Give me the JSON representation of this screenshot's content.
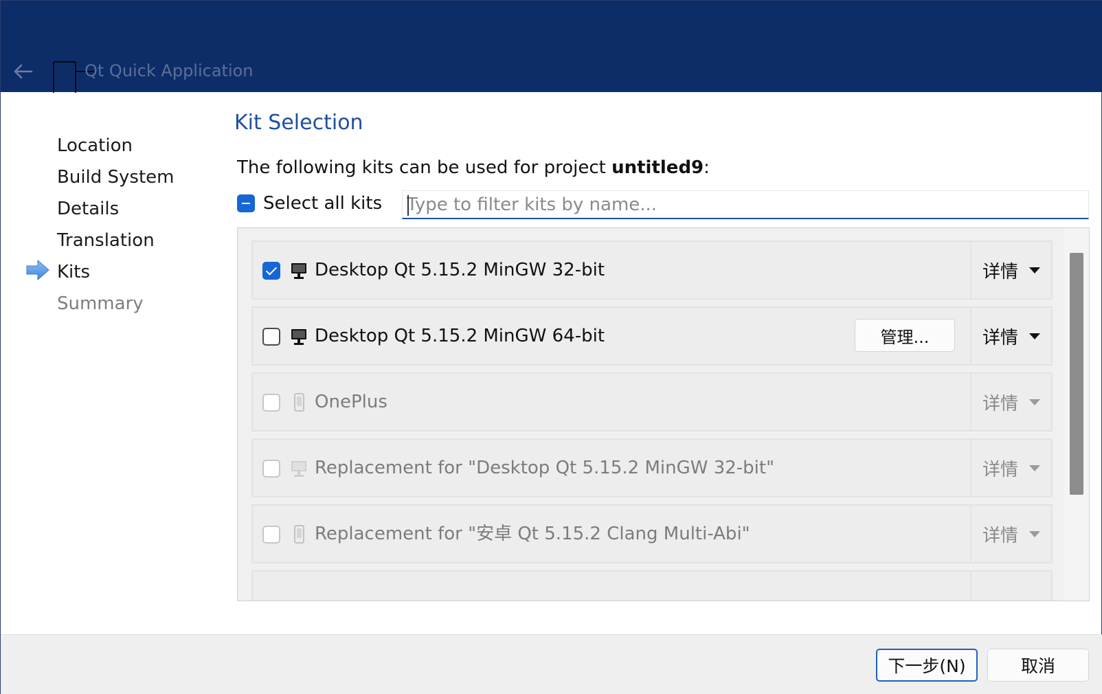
{
  "window": {
    "title": "Qt Quick Application"
  },
  "sidebar": {
    "items": [
      {
        "label": "Location",
        "state": "done"
      },
      {
        "label": "Build System",
        "state": "done"
      },
      {
        "label": "Details",
        "state": "done"
      },
      {
        "label": "Translation",
        "state": "done"
      },
      {
        "label": "Kits",
        "state": "current"
      },
      {
        "label": "Summary",
        "state": "pending"
      }
    ]
  },
  "main": {
    "title": "Kit Selection",
    "description_prefix": "The following kits can be used for project ",
    "project_name": "untitled9",
    "description_suffix": ":",
    "select_all_label": "Select all kits",
    "select_all_state": "indeterminate",
    "filter_placeholder": "Type to filter kits by name...",
    "filter_value": ""
  },
  "kits": [
    {
      "name": "Desktop Qt 5.15.2 MinGW 32-bit",
      "checked": true,
      "enabled": true,
      "icon": "monitor-icon",
      "details_label": "详情",
      "manage_label": null
    },
    {
      "name": "Desktop Qt 5.15.2 MinGW 64-bit",
      "checked": false,
      "enabled": true,
      "icon": "monitor-icon",
      "details_label": "详情",
      "manage_label": "管理..."
    },
    {
      "name": "OnePlus",
      "checked": false,
      "enabled": false,
      "icon": "phone-icon",
      "details_label": "详情",
      "manage_label": null
    },
    {
      "name": "Replacement for \"Desktop Qt 5.15.2 MinGW 32-bit\"",
      "checked": false,
      "enabled": false,
      "icon": "monitor-icon",
      "details_label": "详情",
      "manage_label": null
    },
    {
      "name": "Replacement for \"安卓 Qt 5.15.2 Clang Multi-Abi\"",
      "checked": false,
      "enabled": false,
      "icon": "phone-icon",
      "details_label": "详情",
      "manage_label": null
    }
  ],
  "footer": {
    "next_label": "下一步(N)",
    "cancel_label": "取消"
  },
  "colors": {
    "titlebar": "#0d2d69",
    "accent": "#1666d6",
    "heading": "#1f4fa0"
  }
}
